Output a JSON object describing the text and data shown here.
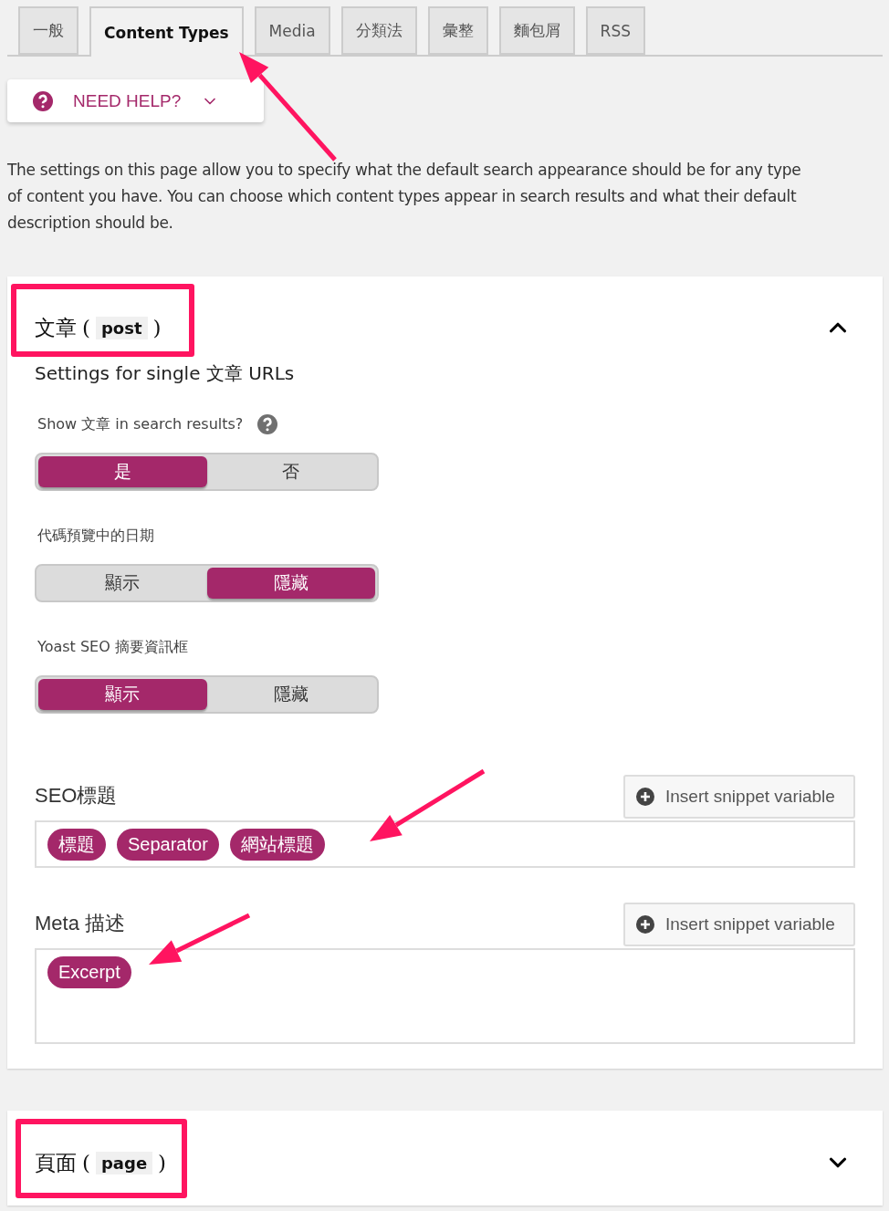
{
  "tabs": [
    {
      "label": "一般",
      "selected": false
    },
    {
      "label": "Content Types",
      "selected": true
    },
    {
      "label": "Media",
      "selected": false
    },
    {
      "label": "分類法",
      "selected": false
    },
    {
      "label": "彙整",
      "selected": false
    },
    {
      "label": "麵包屑",
      "selected": false
    },
    {
      "label": "RSS",
      "selected": false
    }
  ],
  "help": {
    "label": "NEED HELP?",
    "expanded": false
  },
  "intro": "The settings on this page allow you to specify what the default search appearance should be for any type of content you have. You can choose which content types appear in search results and what their default description should be.",
  "sections": [
    {
      "title": "文章",
      "open": "(",
      "slug": "post",
      "close": ")",
      "expanded": true,
      "subtitle": "Settings for single 文章 URLs",
      "settings": [
        {
          "label": "Show 文章 in search results?",
          "help": true,
          "options": [
            {
              "label": "是",
              "selected": true
            },
            {
              "label": "否",
              "selected": false
            }
          ]
        },
        {
          "label": "代碼預覽中的日期",
          "help": false,
          "options": [
            {
              "label": "顯示",
              "selected": false
            },
            {
              "label": "隱藏",
              "selected": true
            }
          ]
        },
        {
          "label": "Yoast SEO 摘要資訊框",
          "help": false,
          "options": [
            {
              "label": "顯示",
              "selected": true
            },
            {
              "label": "隱藏",
              "selected": false
            }
          ]
        }
      ],
      "fields": [
        {
          "label": "SEO標題",
          "button": "Insert snippet variable",
          "tags": [
            "標題",
            "Separator",
            "網站標題"
          ],
          "multiline": false
        },
        {
          "label": "Meta 描述",
          "button": "Insert snippet variable",
          "tags": [
            "Excerpt"
          ],
          "multiline": true
        }
      ]
    },
    {
      "title": "頁面",
      "open": "(",
      "slug": "page",
      "close": ")",
      "expanded": false
    }
  ]
}
